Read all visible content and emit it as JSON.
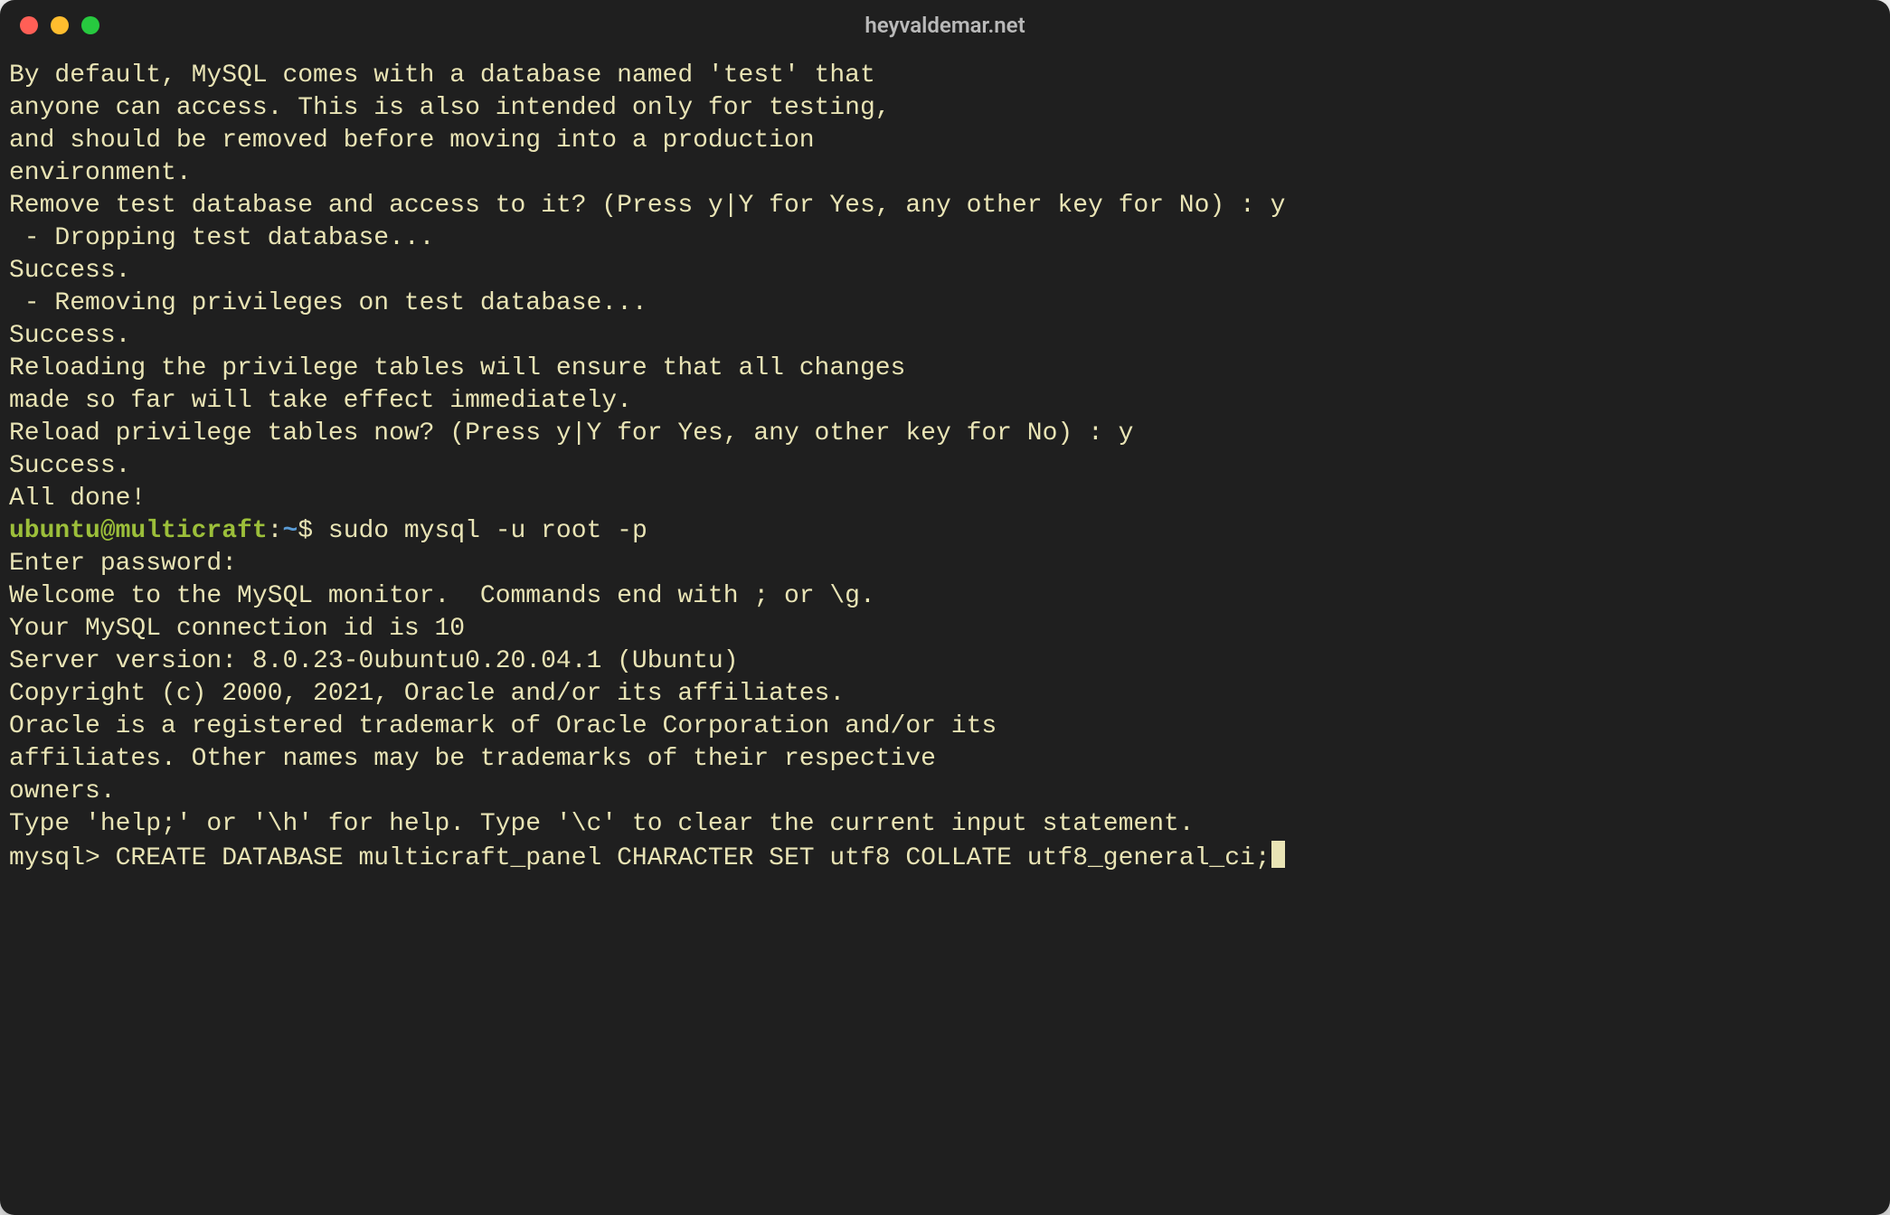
{
  "window": {
    "title": "heyvaldemar.net"
  },
  "colors": {
    "bg": "#1f1f1f",
    "text": "#e9e4b5",
    "user": "#9cbf3a",
    "path": "#5a9bd4"
  },
  "prompt1": {
    "user": "ubuntu@multicraft",
    "colon": ":",
    "path": "~",
    "dollar": "$ ",
    "cmd": "sudo mysql -u root -p"
  },
  "lines": {
    "l00": "By default, MySQL comes with a database named 'test' that",
    "l01": "anyone can access. This is also intended only for testing,",
    "l02": "and should be removed before moving into a production",
    "l03": "environment.",
    "l04": "",
    "l05": "",
    "l06": "Remove test database and access to it? (Press y|Y for Yes, any other key for No) : y",
    "l07": " - Dropping test database...",
    "l08": "Success.",
    "l09": "",
    "l10": " - Removing privileges on test database...",
    "l11": "Success.",
    "l12": "",
    "l13": "Reloading the privilege tables will ensure that all changes",
    "l14": "made so far will take effect immediately.",
    "l15": "",
    "l16": "Reload privilege tables now? (Press y|Y for Yes, any other key for No) : y",
    "l17": "Success.",
    "l18": "",
    "l19": "All done!",
    "l20": "Enter password:",
    "l21": "Welcome to the MySQL monitor.  Commands end with ; or \\g.",
    "l22": "Your MySQL connection id is 10",
    "l23": "Server version: 8.0.23-0ubuntu0.20.04.1 (Ubuntu)",
    "l24": "",
    "l25": "Copyright (c) 2000, 2021, Oracle and/or its affiliates.",
    "l26": "",
    "l27": "Oracle is a registered trademark of Oracle Corporation and/or its",
    "l28": "affiliates. Other names may be trademarks of their respective",
    "l29": "owners.",
    "l30": "",
    "l31": "Type 'help;' or '\\h' for help. Type '\\c' to clear the current input statement.",
    "l32": "",
    "l33_prompt": "mysql> ",
    "l33_cmd": "CREATE DATABASE multicraft_panel CHARACTER SET utf8 COLLATE utf8_general_ci;"
  }
}
